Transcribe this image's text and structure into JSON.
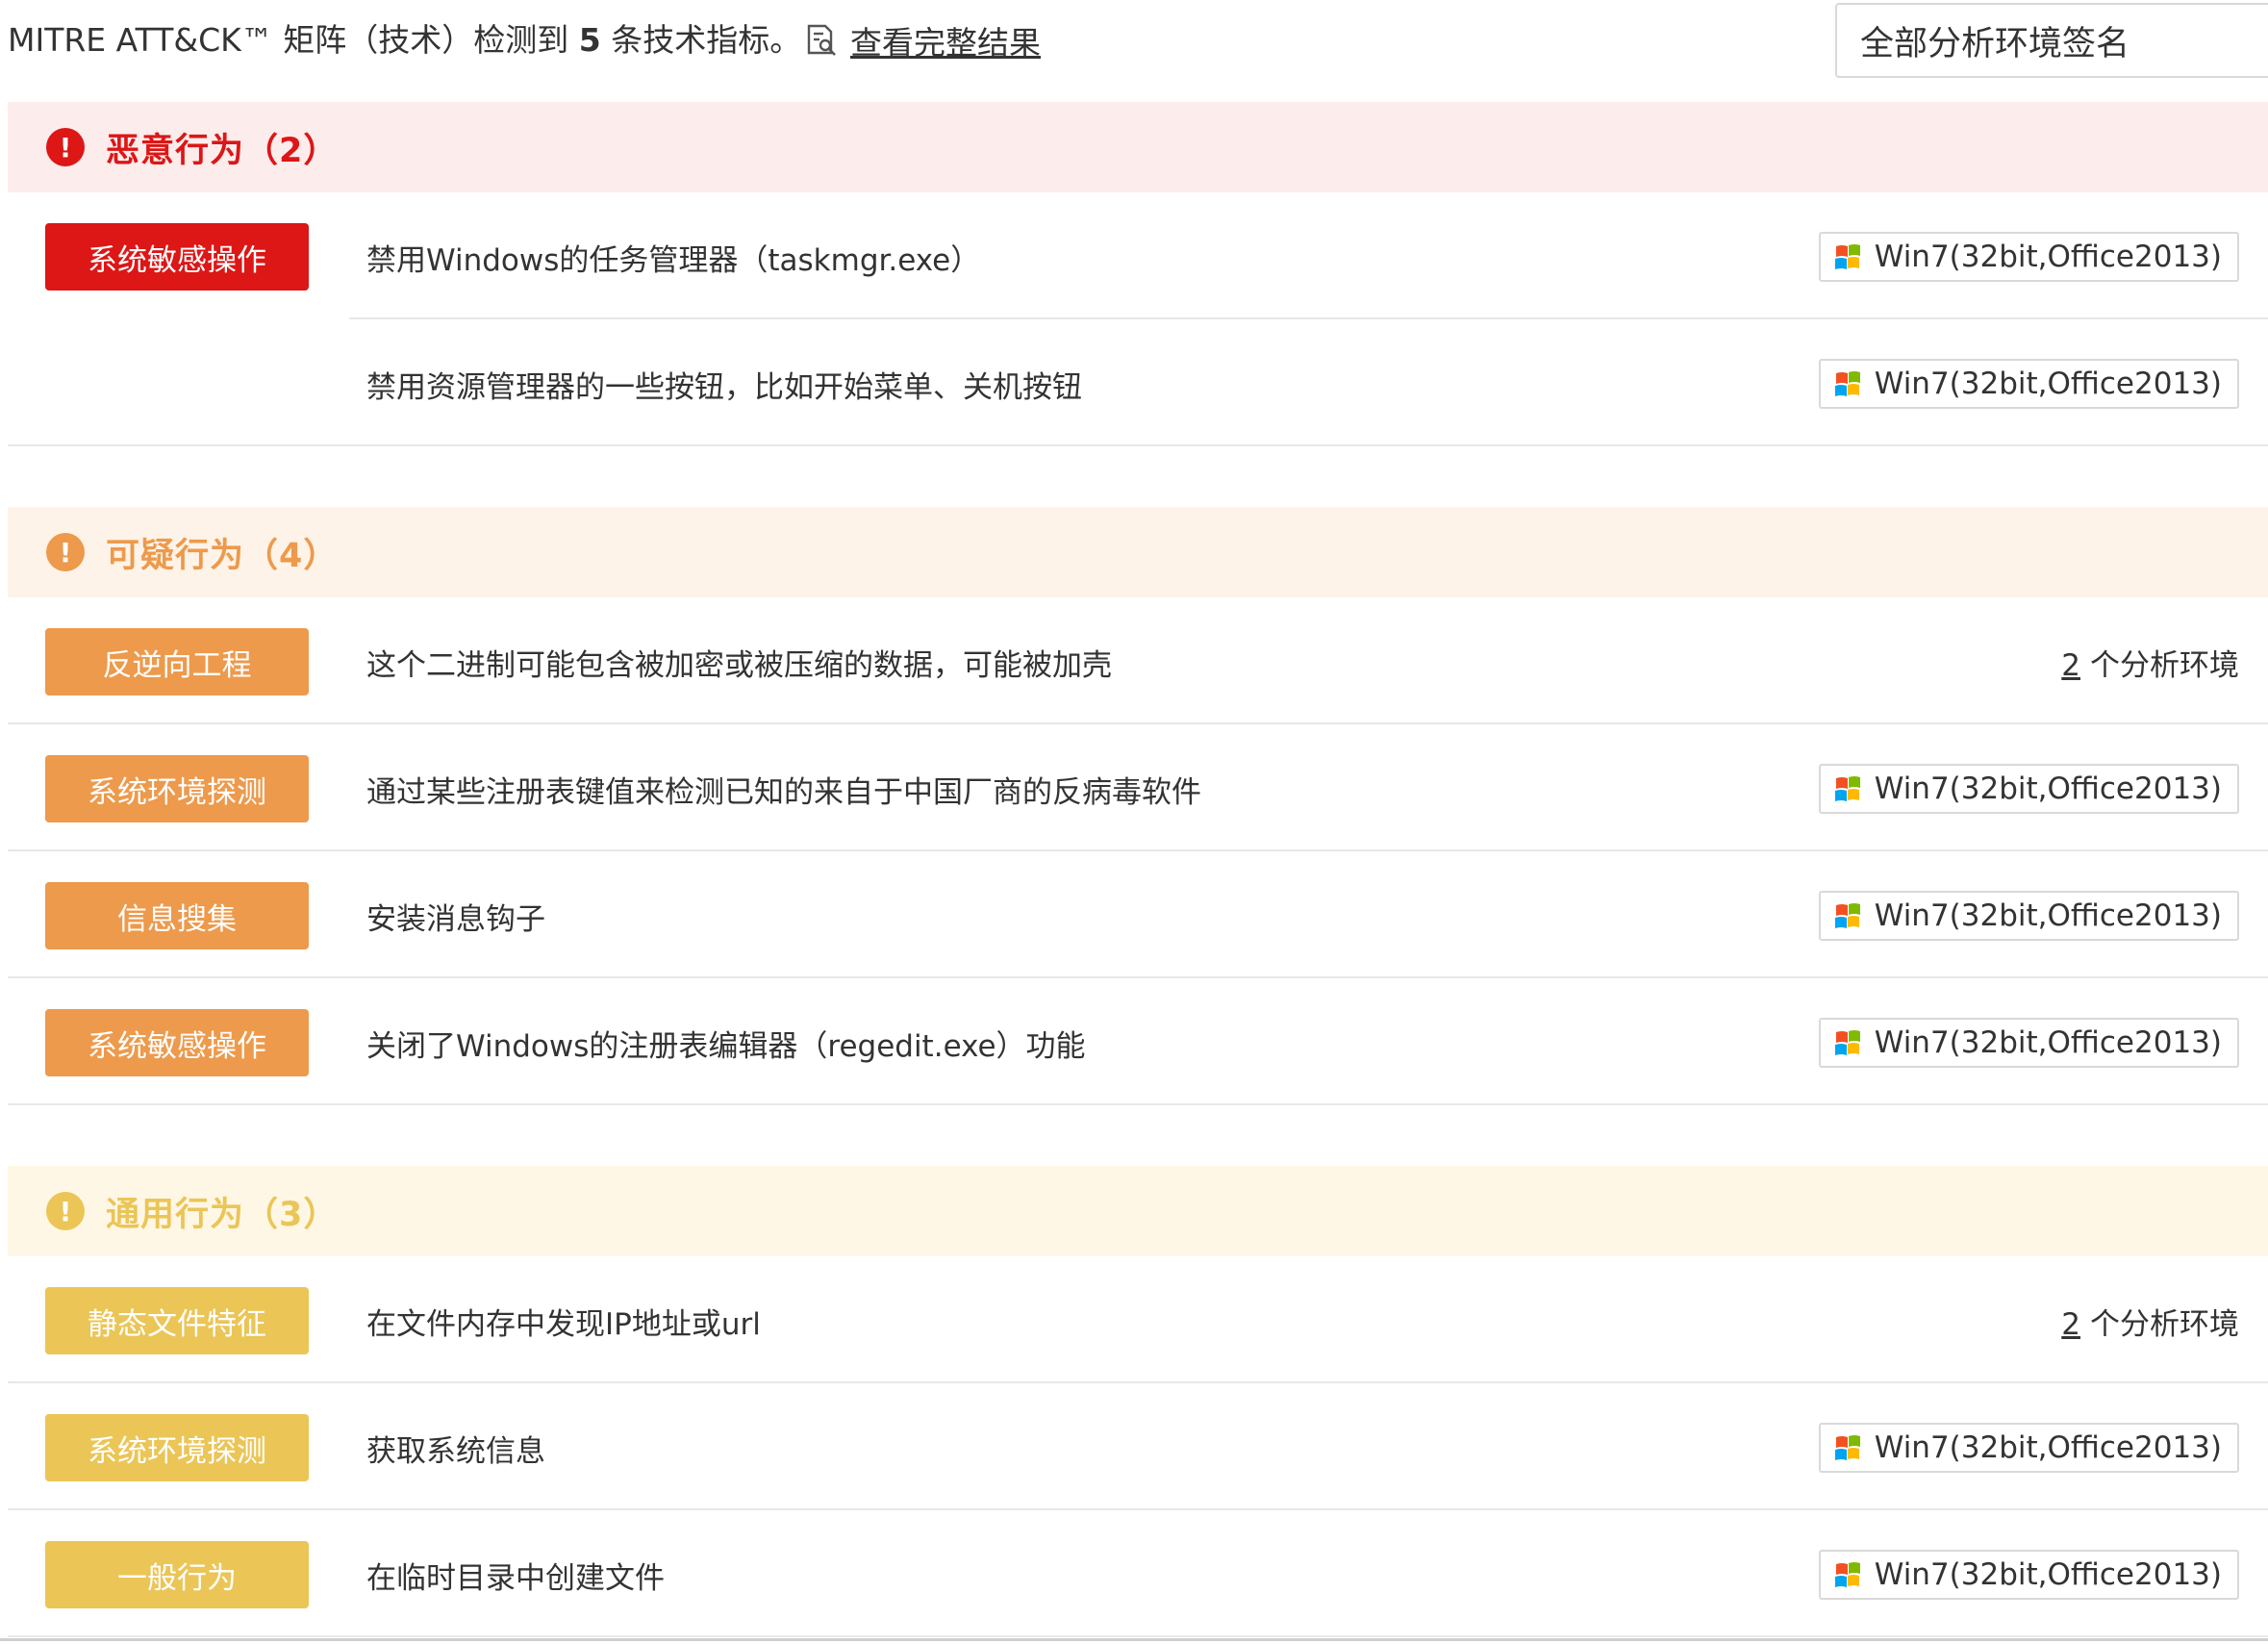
{
  "header": {
    "summary_prefix": "MITRE ATT&CK™ 矩阵（技术）检测到 ",
    "summary_count": "5",
    "summary_suffix": " 条技术指标。",
    "view_full_link": "查看完整结果",
    "env_select_value": "全部分析环境签名"
  },
  "colors": {
    "malicious": "#dd1616",
    "malicious_bg": "#fdecec",
    "suspicious": "#ed9a4c",
    "suspicious_bg": "#fef3e8",
    "general": "#ebc556",
    "general_bg": "#fef7e6"
  },
  "sections": [
    {
      "title": "恶意行为（2）",
      "icon": "exclamation-circle-icon",
      "rows": [
        {
          "tag": "系统敏感操作",
          "description": "禁用Windows的任务管理器（taskmgr.exe）",
          "env": "Win7(32bit,Office2013)"
        },
        {
          "tag": "",
          "description": "禁用资源管理器的一些按钮，比如开始菜单、关机按钮",
          "env": "Win7(32bit,Office2013)"
        }
      ]
    },
    {
      "title": "可疑行为（4）",
      "icon": "exclamation-circle-icon",
      "rows": [
        {
          "tag": "反逆向工程",
          "description": "这个二进制可能包含被加密或被压缩的数据，可能被加壳",
          "env_count": "2",
          "env_count_label": "个分析环境"
        },
        {
          "tag": "系统环境探测",
          "description": "通过某些注册表键值来检测已知的来自于中国厂商的反病毒软件",
          "env": "Win7(32bit,Office2013)"
        },
        {
          "tag": "信息搜集",
          "description": "安装消息钩子",
          "env": "Win7(32bit,Office2013)"
        },
        {
          "tag": "系统敏感操作",
          "description": "关闭了Windows的注册表编辑器（regedit.exe）功能",
          "env": "Win7(32bit,Office2013)"
        }
      ]
    },
    {
      "title": "通用行为（3）",
      "icon": "exclamation-circle-icon",
      "rows": [
        {
          "tag": "静态文件特征",
          "description": "在文件内存中发现IP地址或url",
          "env_count": "2",
          "env_count_label": "个分析环境"
        },
        {
          "tag": "系统环境探测",
          "description": "获取系统信息",
          "env": "Win7(32bit,Office2013)"
        },
        {
          "tag": "一般行为",
          "description": "在临时目录中创建文件",
          "env": "Win7(32bit,Office2013)"
        }
      ]
    }
  ]
}
